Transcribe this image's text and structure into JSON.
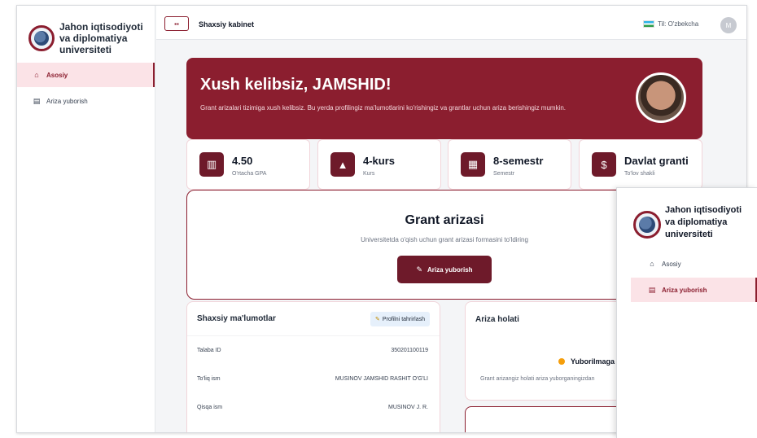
{
  "sidebar": {
    "brand": "Jahon iqtisodiyoti va diplomatiya universiteti",
    "items": [
      {
        "label": "Asosiy",
        "icon": "home-icon"
      },
      {
        "label": "Ariza yuborish",
        "icon": "document-icon"
      }
    ]
  },
  "header": {
    "menu_icon": "grid-icon",
    "title": "Shaxsiy kabinet",
    "language": "Til: O'zbekcha",
    "avatar_initial": "M"
  },
  "hero": {
    "title": "Xush kelibsiz, JAMSHID!",
    "subtitle": "Grant arizalari tizimiga xush kelibsiz. Bu yerda profilingiz ma'lumotlarini ko'rishingiz va grantlar uchun ariza berishingiz mumkin."
  },
  "stats": [
    {
      "value": "4.50",
      "label": "O'rtacha GPA",
      "icon": "books-icon"
    },
    {
      "value": "4-kurs",
      "label": "Kurs",
      "icon": "graduation-cap-icon"
    },
    {
      "value": "8-semestr",
      "label": "Semestr",
      "icon": "calendar-icon"
    },
    {
      "value": "Davlat granti",
      "label": "To'lov shakli",
      "icon": "money-bag-icon"
    }
  ],
  "grant": {
    "title": "Grant arizasi",
    "subtitle": "Universitetda o'qish uchun grant arizasi formasini to'ldiring",
    "button": "Ariza yuborish"
  },
  "personal": {
    "title": "Shaxsiy ma'lumotlar",
    "edit": "Profilni tahrirlash",
    "rows": [
      {
        "label": "Talaba ID",
        "value": "350201100119"
      },
      {
        "label": "To'liq ism",
        "value": "MUSINOV JAMSHID RASHIT O'G'LI"
      },
      {
        "label": "Qisqa ism",
        "value": "MUSINOV J. R."
      }
    ]
  },
  "status": {
    "title": "Ariza holati",
    "state": "Yuborilmaga",
    "note": "Grant arizangiz holati ariza yuborganingizdan",
    "dot_color": "#f59e0b"
  },
  "overlay": {
    "brand": "Jahon iqtisodiyoti va diplomatiya universiteti",
    "items": [
      {
        "label": "Asosiy",
        "icon": "home-icon"
      },
      {
        "label": "Ariza yuborish",
        "icon": "document-icon"
      }
    ]
  },
  "colors": {
    "primary": "#8b1e2f",
    "accent_bg": "#fbe3e7"
  }
}
